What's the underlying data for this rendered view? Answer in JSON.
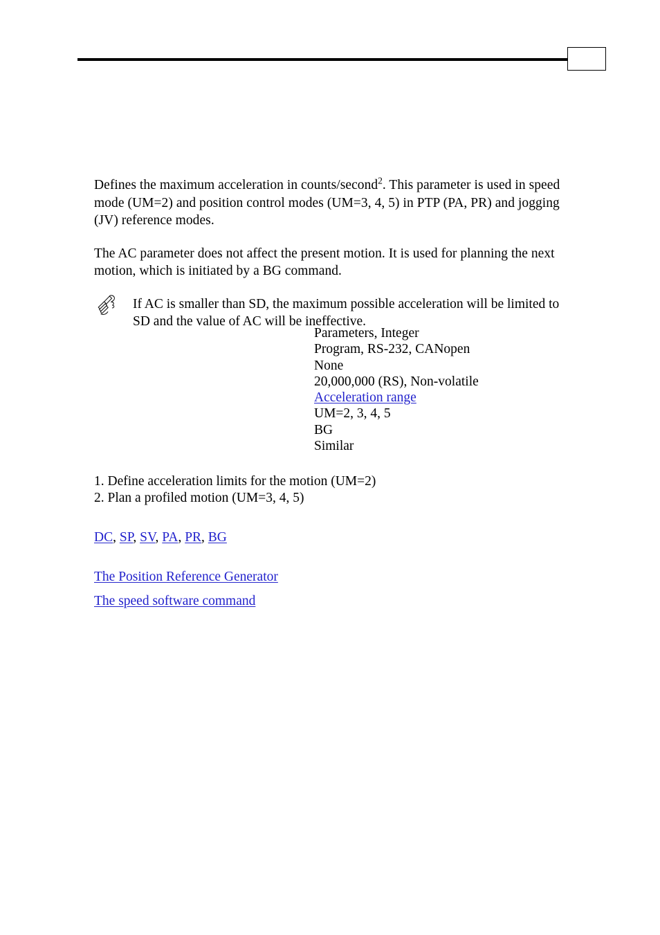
{
  "header": {
    "rule": "horizontal-rule",
    "page_box_label": ""
  },
  "body": {
    "paragraph_1_part1": "Defines the maximum acceleration in counts/second",
    "paragraph_1_sup": "2",
    "paragraph_1_part2": ". This parameter is used in speed mode (UM=2) and position control modes (UM=3, 4, 5) in PTP (PA, PR) and jogging (JV) reference modes.",
    "paragraph_2": "The AC parameter does not affect the present motion. It is used for planning the next motion, which is initiated by a BG command."
  },
  "note": {
    "icon": "writing-hand-icon",
    "text": "If AC is smaller than SD, the maximum possible acceleration will be limited to SD and the value of AC will be ineffective."
  },
  "parameters": {
    "rows": [
      {
        "text": "Parameters, Integer",
        "link": false
      },
      {
        "text": "Program, RS-232, CANopen",
        "link": false
      },
      {
        "text": "None",
        "link": false
      },
      {
        "text": "20,000,000 (RS), Non-volatile",
        "link": false
      },
      {
        "text": "Acceleration range",
        "link": true
      },
      {
        "text": "UM=2, 3, 4, 5",
        "link": false
      },
      {
        "text": "BG",
        "link": false
      },
      {
        "text": "Similar",
        "link": false
      }
    ]
  },
  "numbered_list": {
    "items": [
      "1. Define acceleration limits for the motion (UM=2)",
      "2. Plan a profiled motion (UM=3, 4, 5)"
    ]
  },
  "see_also": {
    "inline_links": [
      "DC",
      "SP",
      "SV",
      "PA",
      "PR",
      "BG"
    ],
    "separator": ", ",
    "block_link_1": "The Position Reference Generator",
    "block_link_2": "The speed software command"
  },
  "colors": {
    "link": "#2222cc",
    "text": "#000000",
    "background": "#ffffff"
  }
}
